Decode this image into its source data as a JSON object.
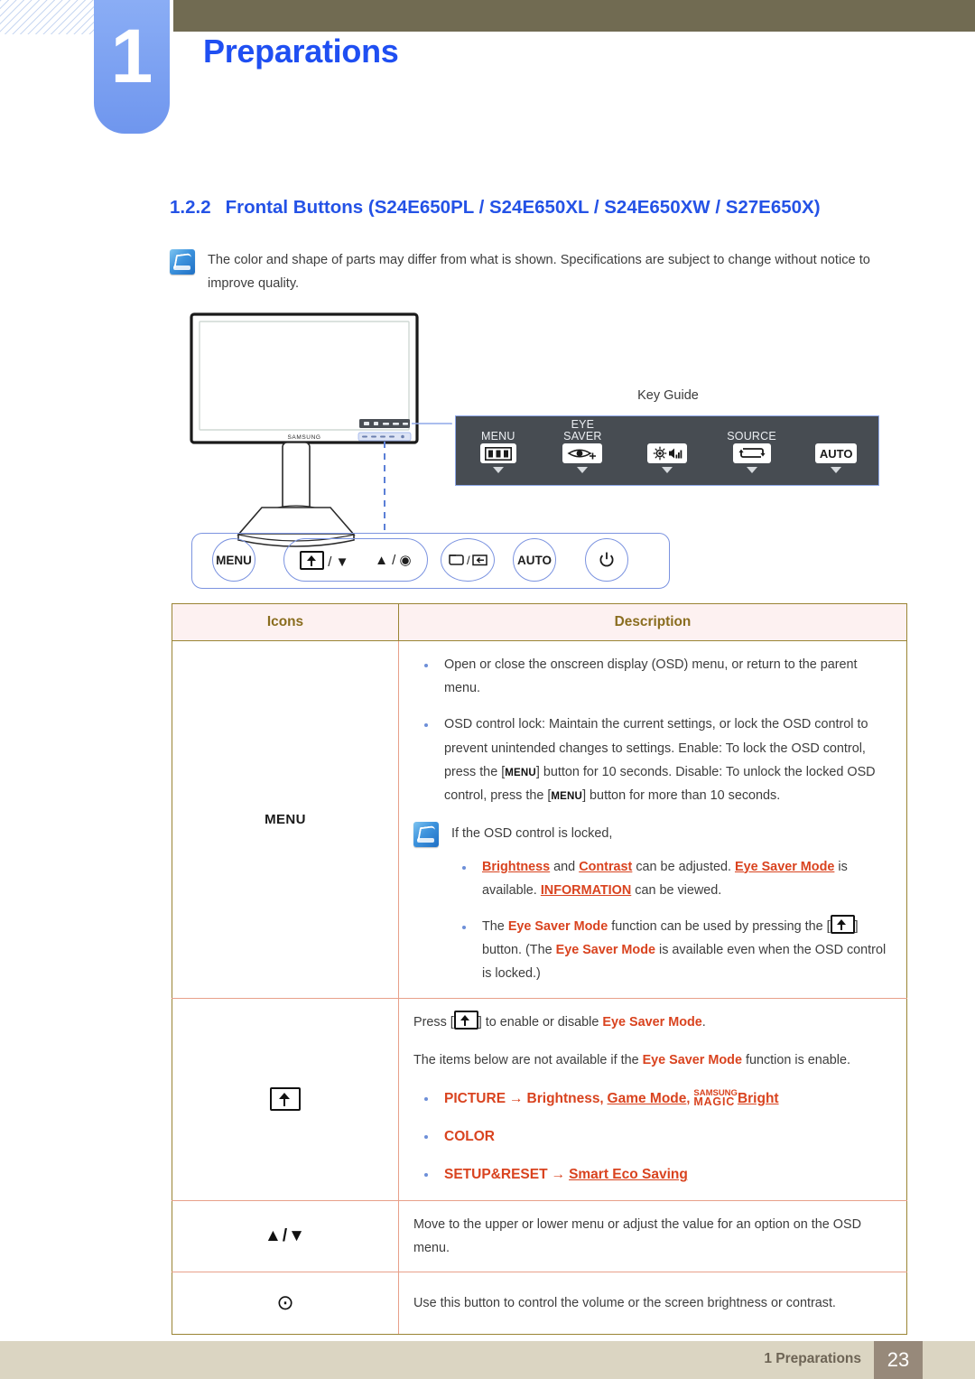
{
  "header": {
    "chapter_number": "1",
    "chapter_title": "Preparations"
  },
  "section": {
    "number": "1.2.2",
    "title": "Frontal Buttons (S24E650PL / S24E650XL / S24E650XW / S27E650X)"
  },
  "top_note": {
    "icon": "note-icon",
    "text": "The color and shape of parts may differ from what is shown. Specifications are subject to change without notice to improve quality."
  },
  "figure": {
    "key_guide_label": "Key Guide",
    "key_guide_items": [
      {
        "label_line1": "",
        "label_line2": "MENU",
        "glyph": "menu-bars-icon"
      },
      {
        "label_line1": "EYE",
        "label_line2": "SAVER",
        "glyph": "eye-plus-icon"
      },
      {
        "label_line1": "",
        "label_line2": "",
        "glyph": "brightness-volume-icon"
      },
      {
        "label_line1": "",
        "label_line2": "SOURCE",
        "glyph": "source-loop-icon"
      },
      {
        "label_line1": "",
        "label_line2": "",
        "glyph": "auto-text-icon",
        "text": "AUTO"
      }
    ],
    "front_buttons": [
      {
        "name": "menu-button",
        "text": "MENU"
      },
      {
        "name": "eyesaver-down-button",
        "text": "/ ▼"
      },
      {
        "name": "up-enter-button",
        "text": "▲ / ⊙"
      },
      {
        "name": "source-return-button",
        "text": "/"
      },
      {
        "name": "auto-button",
        "text": "AUTO"
      },
      {
        "name": "power-button",
        "text": "⏻"
      }
    ]
  },
  "table": {
    "headers": [
      "Icons",
      "Description"
    ],
    "rows": [
      {
        "icon_label": "MENU",
        "bullets": [
          "Open or close the onscreen display (OSD) menu, or return to the parent menu.",
          "OSD control lock: Maintain the current settings, or lock the OSD control to prevent unintended changes to settings. Enable: To lock the OSD control, press the [MENU] button for 10 seconds. Disable: To unlock the locked OSD control, press the [MENU] button for more than 10 seconds."
        ],
        "inner_note": {
          "title": "If the OSD control is locked,",
          "bullets": [
            "Brightness and Contrast can be adjusted. Eye Saver Mode is available. INFORMATION can be viewed.",
            "The Eye Saver Mode function can be used by pressing the [ ] button. (The Eye Saver Mode is available even when the OSD control is locked.)"
          ]
        }
      },
      {
        "icon_glyph": "eye-saver-box-arrow-icon",
        "line1_prefix": "Press [",
        "line1_suffix": "] to enable or disable ",
        "line1_term": "Eye Saver Mode",
        "line1_end": ".",
        "line2_a": "The items below are not available if the ",
        "line2_term": "Eye Saver Mode",
        "line2_b": " function is enable.",
        "bullets": [
          "PICTURE → Brightness, Game Mode, SAMSUNG MAGIC Bright",
          "COLOR",
          "SETUP&RESET → Smart Eco Saving"
        ]
      },
      {
        "icon_glyph": "up-down-arrows-icon",
        "icon_text": "▲/▼",
        "description": "Move to the upper or lower menu or adjust the value for an option on the OSD menu."
      },
      {
        "icon_glyph": "enter-dot-icon",
        "icon_text": "⊙",
        "description": "Use this button to control the volume or the screen brightness or contrast."
      }
    ]
  },
  "inline_terms": {
    "brightness": "Brightness",
    "contrast": "Contrast",
    "eye_saver_mode": "Eye Saver Mode",
    "information": "INFORMATION",
    "picture": "PICTURE",
    "game_mode": "Game Mode",
    "samsung": "SAMSUNG",
    "magic": "MAGIC",
    "bright": "Bright",
    "color": "COLOR",
    "setup_reset": "SETUP&RESET",
    "smart_eco_saving": "Smart Eco Saving",
    "menu_keycap": "MENU",
    "and_word": "and",
    "can_be_adjusted": "can be adjusted.",
    "is_available": "is available.",
    "can_be_viewed": "can be viewed.",
    "the_word": "The",
    "function_used_by": "function can be used by pressing the [",
    "button_paren": "] button. (The",
    "available_even": "is available even when the OSD control",
    "is_locked": "is locked.)",
    "arrow": "→",
    "comma": ","
  },
  "footer": {
    "text": "1 Preparations",
    "page": "23"
  },
  "colors": {
    "header_bar": "#716b52",
    "chapter_tab": "#6f96ee",
    "title_blue": "#1f4ff2",
    "heading_blue": "#2452e6",
    "table_header_bg": "#fdf1f1",
    "table_header_text": "#8a6d1f",
    "table_outer_border": "#9a8434",
    "table_inner_border": "#e8a08a",
    "accent_red": "#d9431f",
    "key_guide_bg": "#474c52",
    "key_guide_border": "#8fa8e8",
    "footer_bg": "#dbd5c2",
    "footer_page_bg": "#97897a"
  }
}
